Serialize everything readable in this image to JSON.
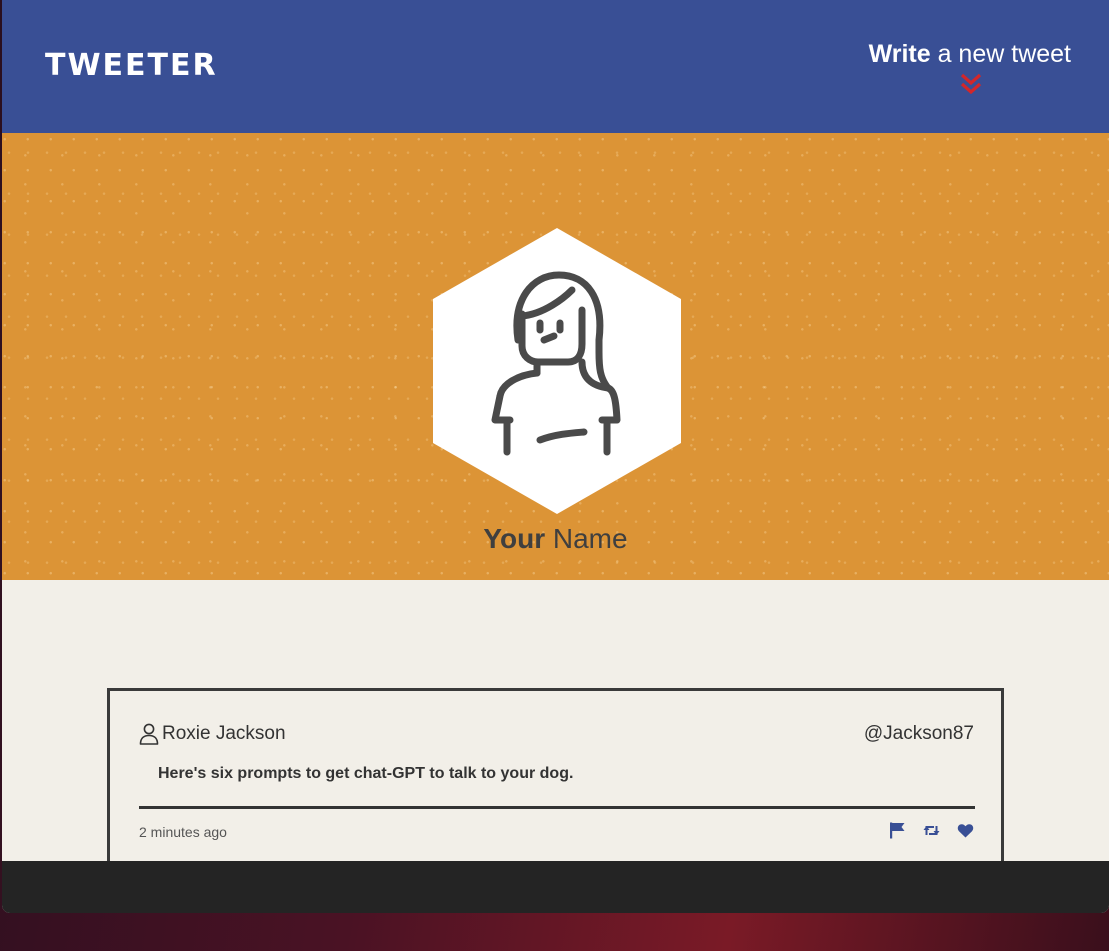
{
  "navbar": {
    "brand": "TWEETER",
    "write_bold": "Write",
    "write_rest": " a new tweet",
    "bg_color": "#394f95",
    "chevron_color": "#d3262a"
  },
  "profile": {
    "name_first": "Your",
    "name_last": " Name",
    "header_color": "#dc9436"
  },
  "tweet": {
    "user_name": "Roxie Jackson",
    "handle": "@Jackson87",
    "text": "Here's six prompts to get chat-GPT to talk to your dog.",
    "time": "2 minutes ago",
    "action_icons": [
      "flag-icon",
      "retweet-icon",
      "heart-icon"
    ],
    "icon_color": "#394f95"
  }
}
